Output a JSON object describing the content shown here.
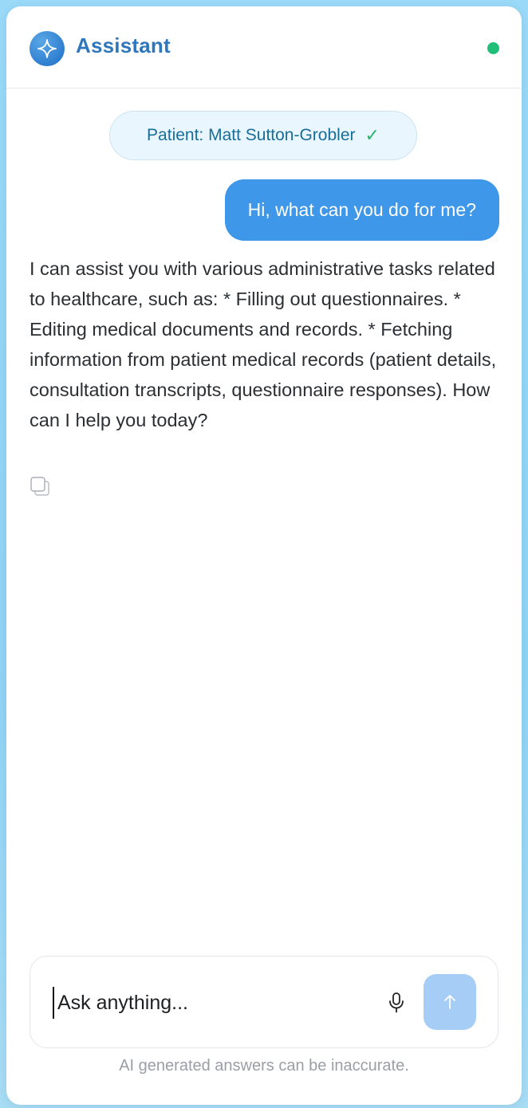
{
  "header": {
    "title": "Assistant",
    "logo_icon": "sparkle-icon",
    "status_color": "#1fbf7a"
  },
  "patient_chip": {
    "label": "Patient: Matt Sutton-Grobler",
    "check": "✓"
  },
  "messages": [
    {
      "role": "user",
      "text": "Hi, what can you do for me?"
    },
    {
      "role": "assistant",
      "text": "I can assist you with various administrative tasks related to healthcare, such as: * Filling out questionnaires. * Editing medical documents and records. * Fetching information from patient medical records (patient details, consultation transcripts, questionnaire responses). How can I help you today?"
    }
  ],
  "composer": {
    "placeholder": "Ask anything...",
    "value": ""
  },
  "disclaimer": "AI generated answers can be inaccurate.",
  "colors": {
    "accent": "#3e97e8",
    "title": "#2f77bd",
    "send_disabled": "#a5cdf5"
  }
}
